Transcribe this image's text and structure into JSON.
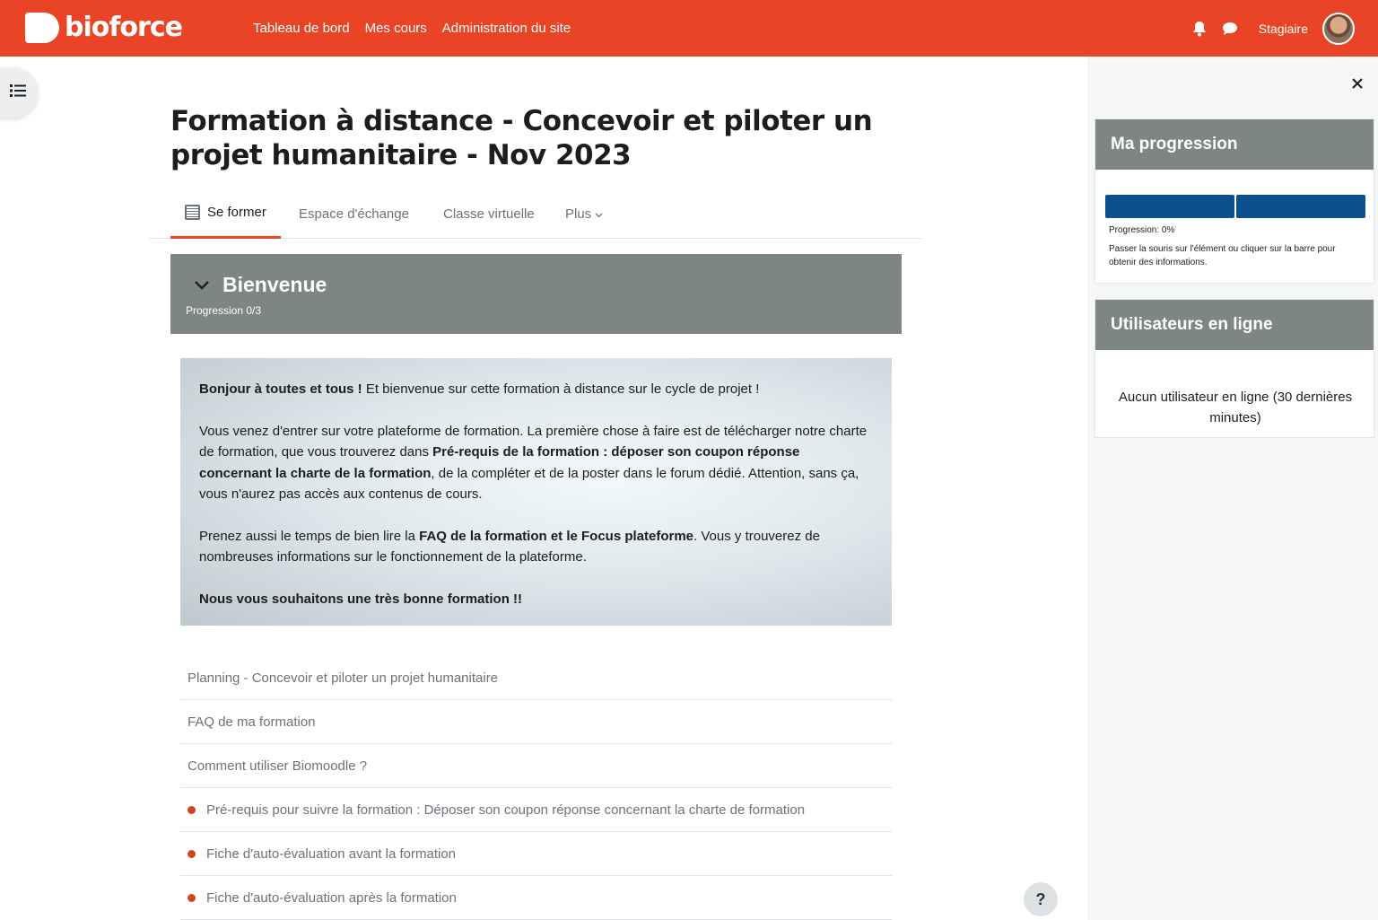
{
  "navbar": {
    "brand": "bioforce",
    "links": [
      "Tableau de bord",
      "Mes cours",
      "Administration du site"
    ],
    "user_name": "Stagiaire",
    "icons": [
      "bell-icon",
      "chat-icon"
    ],
    "color": "#ea4426"
  },
  "course": {
    "title": "Formation à distance - Concevoir et piloter un projet humanitaire - Nov 2023"
  },
  "tabs": [
    {
      "label": "Se former",
      "active": true
    },
    {
      "label": "Espace d'échange"
    },
    {
      "label": "Classe virtuelle"
    },
    {
      "label": "Plus"
    }
  ],
  "section": {
    "title": "Bienvenue",
    "progress": "Progression 0/3"
  },
  "welcome": {
    "p1_bold": "Bonjour à toutes et tous !",
    "p1_rest": " Et bienvenue sur cette formation à distance sur le cycle de projet !",
    "p2_a": "Vous venez d'entrer sur votre plateforme de formation.  La première chose à faire est de télécharger notre charte de formation, que vous trouverez dans ",
    "p2_bold": "Pré-requis de la formation : déposer son coupon réponse concernant la charte de la formation",
    "p2_b": ", de la compléter et de la poster dans le forum dédié. Attention, sans ça, vous n'aurez pas accès aux contenus de cours.",
    "p3_a": "Prenez aussi le temps de bien lire la ",
    "p3_bold": "FAQ de la formation et le Focus plateforme",
    "p3_b": ". Vous y trouverez  de nombreuses informations sur le fonctionnement de la plateforme.",
    "p4_bold": "Nous vous souhaitons une très bonne formation !!"
  },
  "activities": [
    {
      "label": "Planning - Concevoir et piloter un projet humanitaire",
      "dot": false
    },
    {
      "label": "FAQ de ma formation",
      "dot": false
    },
    {
      "label": "Comment utiliser Biomoodle ?",
      "dot": false
    },
    {
      "label": "Pré-requis pour suivre la formation : Déposer son coupon réponse concernant la charte de formation",
      "dot": true
    },
    {
      "label": "Fiche d'auto-évaluation avant la formation",
      "dot": true
    },
    {
      "label": "Fiche d'auto-évaluation après la formation",
      "dot": true
    }
  ],
  "help": "?",
  "drawer": {
    "progress_block": {
      "title": "Ma progression",
      "progress_value": 0,
      "label": "Progression: 0%",
      "hint": "Passer la souris sur l'élément ou cliquer sur la barre pour obtenir des informations."
    },
    "online_block": {
      "title": "Utilisateurs en ligne",
      "text": "Aucun utilisateur en ligne (30 dernières minutes)"
    }
  }
}
